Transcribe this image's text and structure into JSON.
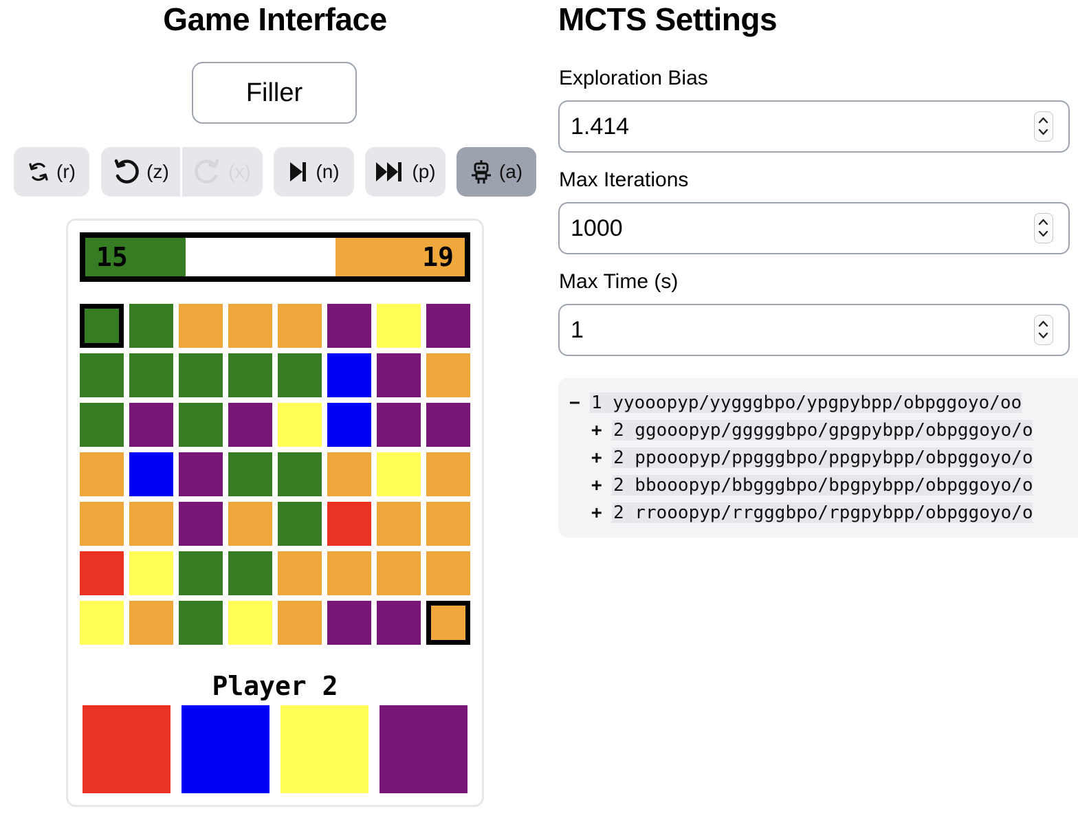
{
  "game_panel": {
    "title": "Game Interface",
    "game_name_button": "Filler",
    "toolbar": {
      "reset_key": "(r)",
      "undo_key": "(z)",
      "redo_key": "(x)",
      "step_key": "(n)",
      "play_key": "(p)",
      "ai_key": "(a)"
    },
    "score": {
      "player1": "15",
      "player2": "19",
      "player1_fraction": 0.264,
      "player2_fraction": 0.341
    },
    "colors": {
      "g": "#367c23",
      "o": "#f0a83c",
      "p": "#771677",
      "y": "#ffff55",
      "b": "#0000f4",
      "r": "#ea3323"
    },
    "board": [
      "ggooopyp",
      "gggggbpo",
      "gpgpybpp",
      "obpggoyo",
      "oopogroo",
      "ryggoooo",
      "yogyoppo"
    ],
    "turn_label": "Player 2",
    "choice_colors": [
      "#ea3323",
      "#0000f4",
      "#ffff55",
      "#771677"
    ]
  },
  "mcts": {
    "title": "MCTS Settings",
    "exploration_bias_label": "Exploration Bias",
    "exploration_bias_value": "1.414",
    "max_iterations_label": "Max Iterations",
    "max_iterations_value": "1000",
    "max_time_label": "Max Time (s)",
    "max_time_value": "1",
    "tree": [
      {
        "toggle": "−",
        "text": "1 yyooopyp/yygggbpo/ypgpybpp/obpggoyo/oo"
      },
      {
        "toggle": "+",
        "text": "2 ggooopyp/gggggbpo/gpgpybpp/obpggoyo/o"
      },
      {
        "toggle": "+",
        "text": "2 ppooopyp/ppgggbpo/ppgpybpp/obpggoyo/o"
      },
      {
        "toggle": "+",
        "text": "2 bbooopyp/bbgggbpo/bpgpybpp/obpggoyo/o"
      },
      {
        "toggle": "+",
        "text": "2 rrooopyp/rrgggbpo/rpgpybpp/obpggoyo/o"
      }
    ]
  }
}
